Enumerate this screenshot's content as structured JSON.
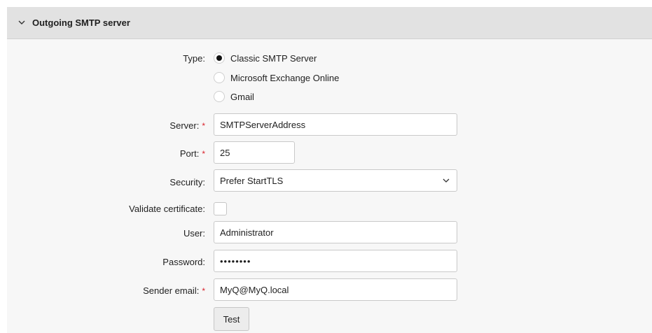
{
  "section": {
    "title": "Outgoing SMTP server",
    "collapse_icon": "chevron-down-icon"
  },
  "form": {
    "type": {
      "label": "Type:",
      "options": [
        {
          "label": "Classic SMTP Server",
          "selected": true
        },
        {
          "label": "Microsoft Exchange Online",
          "selected": false
        },
        {
          "label": "Gmail",
          "selected": false
        }
      ]
    },
    "server": {
      "label": "Server:",
      "value": "SMTPServerAddress",
      "required": true
    },
    "port": {
      "label": "Port:",
      "value": "25",
      "required": true
    },
    "security": {
      "label": "Security:",
      "value": "Prefer StartTLS",
      "icon": "chevron-down-icon"
    },
    "validate_certificate": {
      "label": "Validate certificate:",
      "checked": false
    },
    "user": {
      "label": "User:",
      "value": "Administrator"
    },
    "password": {
      "label": "Password:",
      "value": "••••••••"
    },
    "sender_email": {
      "label": "Sender email:",
      "value": "MyQ@MyQ.local",
      "required": true
    },
    "test_button": {
      "label": "Test"
    }
  },
  "required_marker": "*",
  "colors": {
    "header_bg": "#e2e2e2",
    "panel_bg": "#f7f7f7",
    "required": "#d9232d"
  }
}
